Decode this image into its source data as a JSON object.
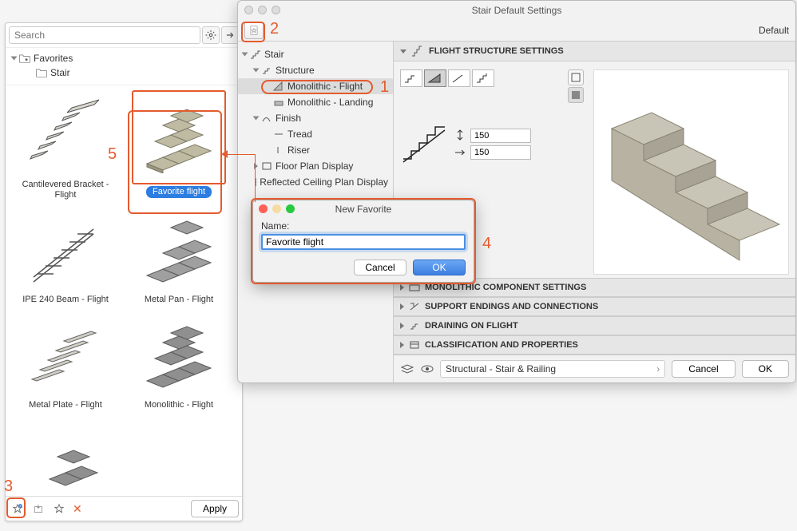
{
  "annotations": {
    "n1": "1",
    "n2": "2",
    "n3": "3",
    "n4": "4",
    "n5": "5"
  },
  "fav_panel": {
    "search_placeholder": "Search",
    "tree": {
      "root": "Favorites",
      "child": "Stair"
    },
    "thumbs": [
      {
        "label": "Cantilevered Bracket - Flight"
      },
      {
        "label": "Favorite flight",
        "selected": true
      },
      {
        "label": "IPE 240 Beam - Flight"
      },
      {
        "label": "Metal Pan - Flight"
      },
      {
        "label": "Metal Plate - Flight"
      },
      {
        "label": "Monolithic - Flight"
      }
    ],
    "apply": "Apply"
  },
  "settings": {
    "title": "Stair Default Settings",
    "default_label": "Default",
    "tree": {
      "root": "Stair",
      "structure": "Structure",
      "monolithic_flight": "Monolithic - Flight",
      "monolithic_landing": "Monolithic - Landing",
      "finish": "Finish",
      "tread": "Tread",
      "riser": "Riser",
      "floor_plan": "Floor Plan Display",
      "rcp": "Reflected Ceiling Plan Display"
    },
    "section_flight": "FLIGHT STRUCTURE SETTINGS",
    "val1": "150",
    "val2": "150",
    "sections": {
      "monolithic": "MONOLITHIC COMPONENT SETTINGS",
      "support": "SUPPORT ENDINGS AND CONNECTIONS",
      "draining": "DRAINING ON FLIGHT",
      "classification": "CLASSIFICATION AND PROPERTIES"
    },
    "layer": "Structural - Stair & Railing",
    "cancel": "Cancel",
    "ok": "OK"
  },
  "dialog": {
    "title": "New Favorite",
    "name_label": "Name:",
    "name_value": "Favorite flight",
    "cancel": "Cancel",
    "ok": "OK"
  }
}
